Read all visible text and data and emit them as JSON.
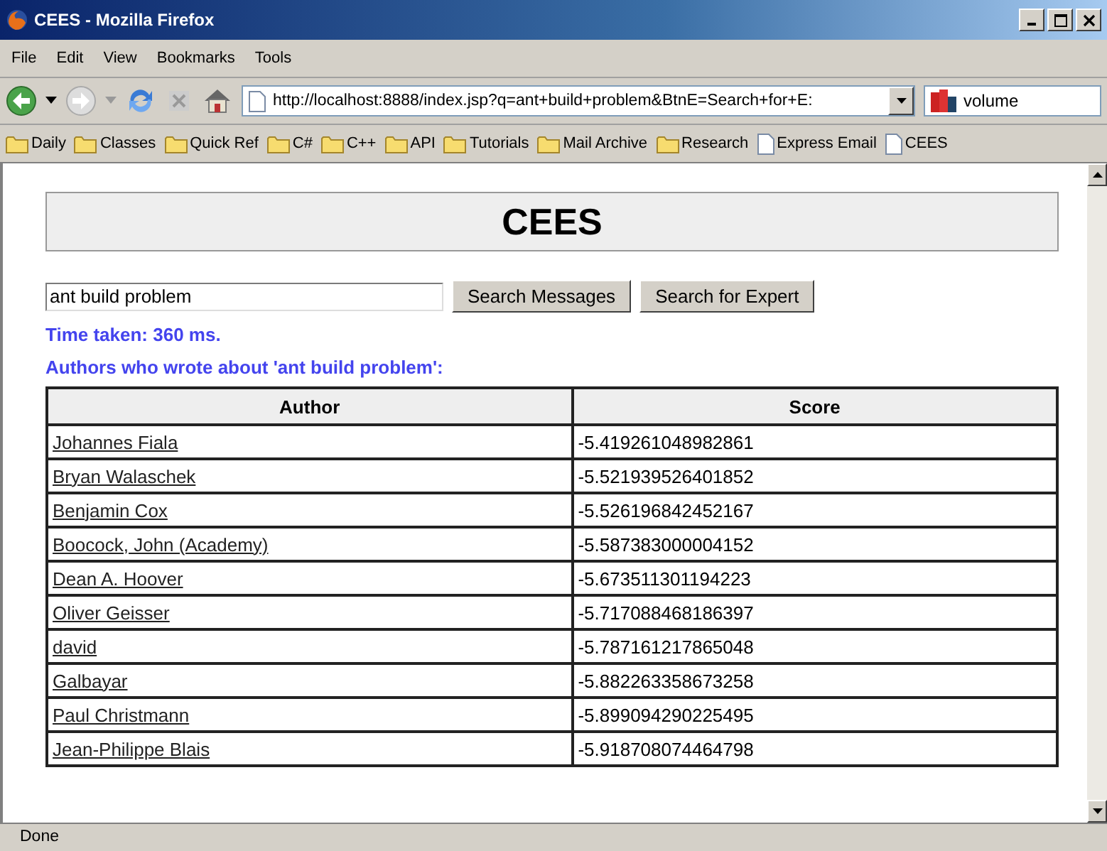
{
  "window": {
    "title": "CEES - Mozilla Firefox"
  },
  "menu": [
    "File",
    "Edit",
    "View",
    "Bookmarks",
    "Tools"
  ],
  "address": {
    "value": "http://localhost:8888/index.jsp?q=ant+build+problem&BtnE=Search+for+E:"
  },
  "search_bar": {
    "value": "volume"
  },
  "bookmarks": [
    {
      "label": "Daily",
      "kind": "folder"
    },
    {
      "label": "Classes",
      "kind": "folder"
    },
    {
      "label": "Quick Ref",
      "kind": "folder"
    },
    {
      "label": "C#",
      "kind": "folder"
    },
    {
      "label": "C++",
      "kind": "folder"
    },
    {
      "label": "API",
      "kind": "folder"
    },
    {
      "label": "Tutorials",
      "kind": "folder"
    },
    {
      "label": "Mail Archive",
      "kind": "folder"
    },
    {
      "label": "Research",
      "kind": "folder"
    },
    {
      "label": "Express Email",
      "kind": "page"
    },
    {
      "label": "CEES",
      "kind": "page"
    }
  ],
  "page": {
    "heading": "CEES",
    "query": {
      "value": "ant build problem"
    },
    "buttons": [
      "Search Messages",
      "Search for Expert"
    ],
    "time_taken": "Time taken: 360 ms.",
    "results_caption": "Authors who wrote about 'ant build problem':",
    "table": {
      "columns": [
        "Author",
        "Score"
      ],
      "rows": [
        {
          "author": "Johannes Fiala",
          "score": "-5.419261048982861"
        },
        {
          "author": "Bryan Walaschek",
          "score": "-5.521939526401852"
        },
        {
          "author": "Benjamin Cox",
          "score": "-5.526196842452167"
        },
        {
          "author": "Boocock, John (Academy)",
          "score": "-5.587383000004152"
        },
        {
          "author": "Dean A. Hoover",
          "score": "-5.673511301194223"
        },
        {
          "author": "Oliver Geisser",
          "score": "-5.717088468186397"
        },
        {
          "author": "david",
          "score": "-5.787161217865048"
        },
        {
          "author": "Galbayar",
          "score": "-5.882263358673258"
        },
        {
          "author": "Paul Christmann",
          "score": "-5.899094290225495"
        },
        {
          "author": "Jean-Philippe Blais",
          "score": "-5.918708074464798"
        }
      ]
    }
  },
  "status_bar": "Done"
}
